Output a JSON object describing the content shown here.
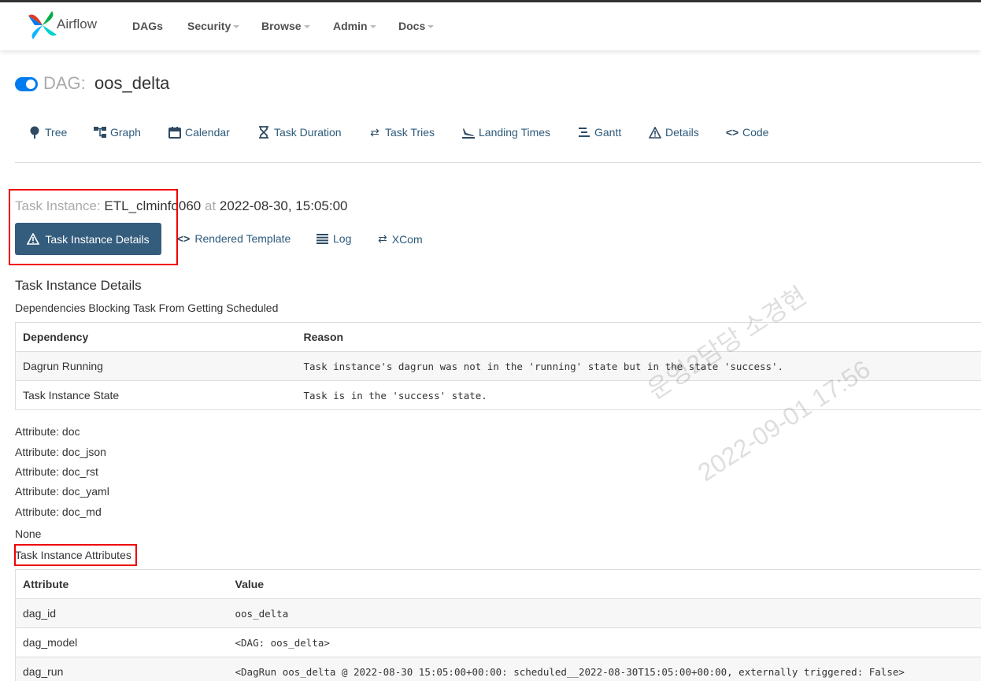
{
  "navbar": {
    "brand": "Airflow",
    "items": [
      {
        "label": "DAGs",
        "dropdown": false
      },
      {
        "label": "Security",
        "dropdown": true
      },
      {
        "label": "Browse",
        "dropdown": true
      },
      {
        "label": "Admin",
        "dropdown": true
      },
      {
        "label": "Docs",
        "dropdown": true
      }
    ]
  },
  "dag": {
    "prefix": "DAG:",
    "name": "oos_delta",
    "paused": false
  },
  "view_tabs": [
    {
      "label": "Tree",
      "icon": "tree-icon"
    },
    {
      "label": "Graph",
      "icon": "graph-icon"
    },
    {
      "label": "Calendar",
      "icon": "calendar-icon"
    },
    {
      "label": "Task Duration",
      "icon": "hourglass-icon"
    },
    {
      "label": "Task Tries",
      "icon": "swap-icon"
    },
    {
      "label": "Landing Times",
      "icon": "plane-landing-icon"
    },
    {
      "label": "Gantt",
      "icon": "gantt-icon"
    },
    {
      "label": "Details",
      "icon": "warning-icon"
    },
    {
      "label": "Code",
      "icon": "code-icon"
    }
  ],
  "task_instance": {
    "prefix": "Task Instance:",
    "task_id": "ETL_clminfo060",
    "at": "at",
    "date": "2022-08-30, 15:05:00"
  },
  "ti_tabs": [
    {
      "label": "Task Instance Details",
      "active": true,
      "icon": "warning-icon"
    },
    {
      "label": "Rendered Template",
      "active": false,
      "icon": "code-icon"
    },
    {
      "label": "Log",
      "active": false,
      "icon": "list-icon"
    },
    {
      "label": "XCom",
      "active": false,
      "icon": "swap-icon"
    }
  ],
  "details": {
    "heading": "Task Instance Details",
    "deps_heading": "Dependencies Blocking Task From Getting Scheduled",
    "deps_table": {
      "headers": [
        "Dependency",
        "Reason"
      ],
      "rows": [
        [
          "Dagrun Running",
          "Task instance's dagrun was not in the 'running' state but in the state 'success'."
        ],
        [
          "Task Instance State",
          "Task is in the 'success' state."
        ]
      ]
    },
    "attributes": [
      "Attribute: doc",
      "Attribute: doc_json",
      "Attribute: doc_rst",
      "Attribute: doc_yaml",
      "Attribute: doc_md"
    ],
    "none_text": "None",
    "attrs_heading": "Task Instance Attributes",
    "attrs_table": {
      "headers": [
        "Attribute",
        "Value"
      ],
      "rows": [
        [
          "dag_id",
          "oos_delta"
        ],
        [
          "dag_model",
          "<DAG: oos_delta>"
        ],
        [
          "dag_run",
          "<DagRun oos_delta @ 2022-08-30 15:05:00+00:00: scheduled__2022-08-30T15:05:00+00:00, externally triggered: False>"
        ]
      ]
    }
  },
  "watermark": {
    "line1": "운영2담당 소경현",
    "line2": "2022-09-01 17:56"
  },
  "colors": {
    "accent": "#345c7d",
    "link": "#2d5a7b",
    "toggle": "#017cee",
    "highlight": "#ee0000"
  }
}
